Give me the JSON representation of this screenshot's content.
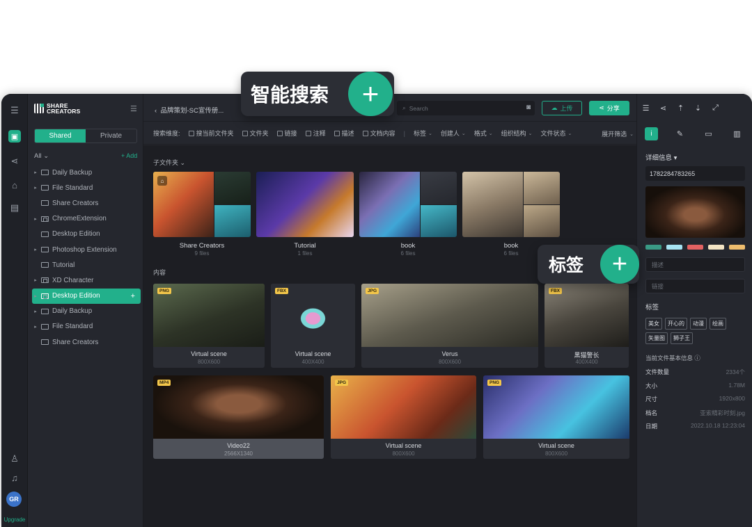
{
  "rail": {
    "upgrade": "Upgrade",
    "avatar": "GR"
  },
  "sidebar": {
    "logo": "SHARE CREATORS",
    "tabs": {
      "shared": "Shared",
      "private": "Private"
    },
    "all": "All",
    "add": "+ Add",
    "items": [
      {
        "label": "Daily Backup",
        "arrow": true,
        "lock": false
      },
      {
        "label": "File Standard",
        "arrow": true,
        "lock": false
      },
      {
        "label": "Share Creators",
        "arrow": false,
        "lock": false
      },
      {
        "label": "ChromeExtension",
        "arrow": true,
        "lock": true
      },
      {
        "label": "Desktop Edition",
        "arrow": false,
        "lock": false
      },
      {
        "label": "Photoshop Extension",
        "arrow": true,
        "lock": false
      },
      {
        "label": "Tutorial",
        "arrow": false,
        "lock": false
      },
      {
        "label": "XD Character",
        "arrow": true,
        "lock": true
      },
      {
        "label": "Desktop Edition",
        "arrow": true,
        "lock": true,
        "selected": true
      },
      {
        "label": "Daily Backup",
        "arrow": true,
        "lock": false
      },
      {
        "label": "File Standard",
        "arrow": true,
        "lock": false
      },
      {
        "label": "Share Creators",
        "arrow": false,
        "lock": false
      }
    ]
  },
  "topbar": {
    "breadcrumb": "品牌策划-SC宣传册...",
    "search_placeholder": "Search",
    "upload": "上传",
    "share": "分享"
  },
  "filters": {
    "label": "搜索维度:",
    "checks": [
      "搜当前文件夹",
      "文件夹",
      "链接",
      "注释",
      "描述",
      "文档内容"
    ],
    "dropdowns": [
      "标签",
      "创建人",
      "格式",
      "组织结构",
      "文件状态"
    ],
    "expand": "展开筛选"
  },
  "main": {
    "subfolders_title": "子文件夹",
    "content_title": "内容",
    "folders": [
      {
        "name": "Share Creators",
        "count": "9 files"
      },
      {
        "name": "Tutorial",
        "count": "1 files"
      },
      {
        "name": "book",
        "count": "6 files"
      },
      {
        "name": "book",
        "count": "6 files"
      }
    ],
    "row1": [
      {
        "badge": "PNG",
        "title": "Virtual scene",
        "size": "800X600"
      },
      {
        "badge": "FBX",
        "title": "Virtual scene",
        "size": "400X400"
      },
      {
        "badge": "JPG",
        "title": "Verus",
        "size": "800X600"
      },
      {
        "badge": "FBX",
        "title": "黑猫警长",
        "size": "400X400"
      }
    ],
    "row2": [
      {
        "badge": "MP4",
        "title": "Video22",
        "size": "2566X1340"
      },
      {
        "badge": "JPG",
        "title": "Virtual scene",
        "size": "800X600"
      },
      {
        "badge": "PNG",
        "title": "Virtual scene",
        "size": "800X600"
      }
    ]
  },
  "right": {
    "detail": "详细信息",
    "id": "1782284783265",
    "swatches": [
      "#3a9a85",
      "#a6e3f2",
      "#e36262",
      "#f3e4c4",
      "#eebd6e"
    ],
    "desc_placeholder": "描述",
    "link_placeholder": "链接",
    "tags_title": "标签",
    "tags": [
      "美女",
      "开心的",
      "动漫",
      "绘画",
      "矢量图",
      "狮子王"
    ],
    "info_title": "当前文件基本信息",
    "meta": [
      {
        "k": "文件数量",
        "v": "2334个"
      },
      {
        "k": "大小",
        "v": "1.78M"
      },
      {
        "k": "尺寸",
        "v": "1920x800"
      },
      {
        "k": "档名",
        "v": "亚索精彩时刻.jpg"
      },
      {
        "k": "日期",
        "v": "2022.10.18 12:23:04"
      }
    ]
  },
  "callouts": {
    "search": "智能搜索",
    "tags": "标签"
  }
}
